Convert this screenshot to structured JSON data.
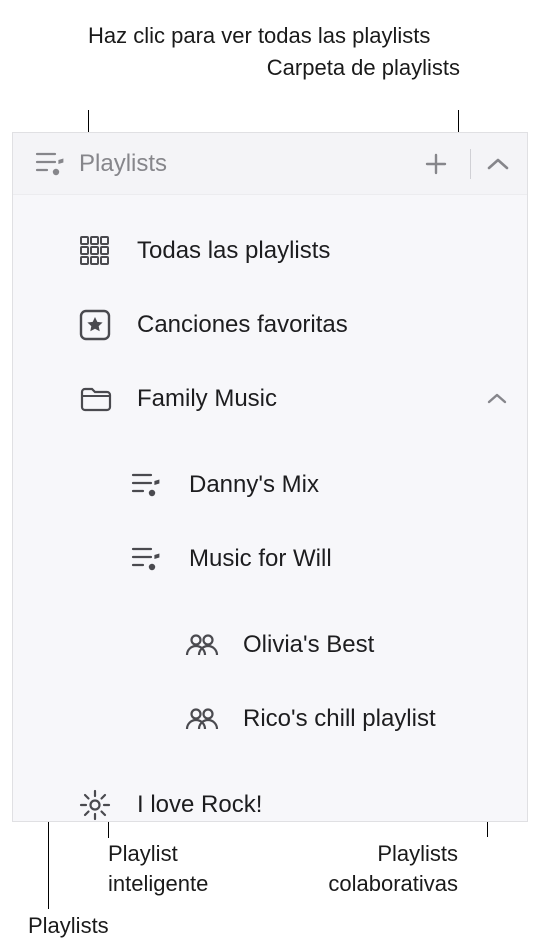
{
  "annotations": {
    "click_all": "Haz clic para ver todas las playlists",
    "folder": "Carpeta de playlists",
    "smart": "Playlist",
    "smart2": "inteligente",
    "collab": "Playlists",
    "collab2": "colaborativas",
    "playlists": "Playlists"
  },
  "header": {
    "title": "Playlists"
  },
  "items": {
    "all": "Todas las playlists",
    "fav": "Canciones favoritas",
    "folder": "Family Music",
    "folder_children": {
      "danny": "Danny's Mix",
      "will": "Music for Will",
      "olivia": "Olivia's Best",
      "rico": "Rico's chill playlist"
    },
    "smart": "I love Rock!"
  }
}
